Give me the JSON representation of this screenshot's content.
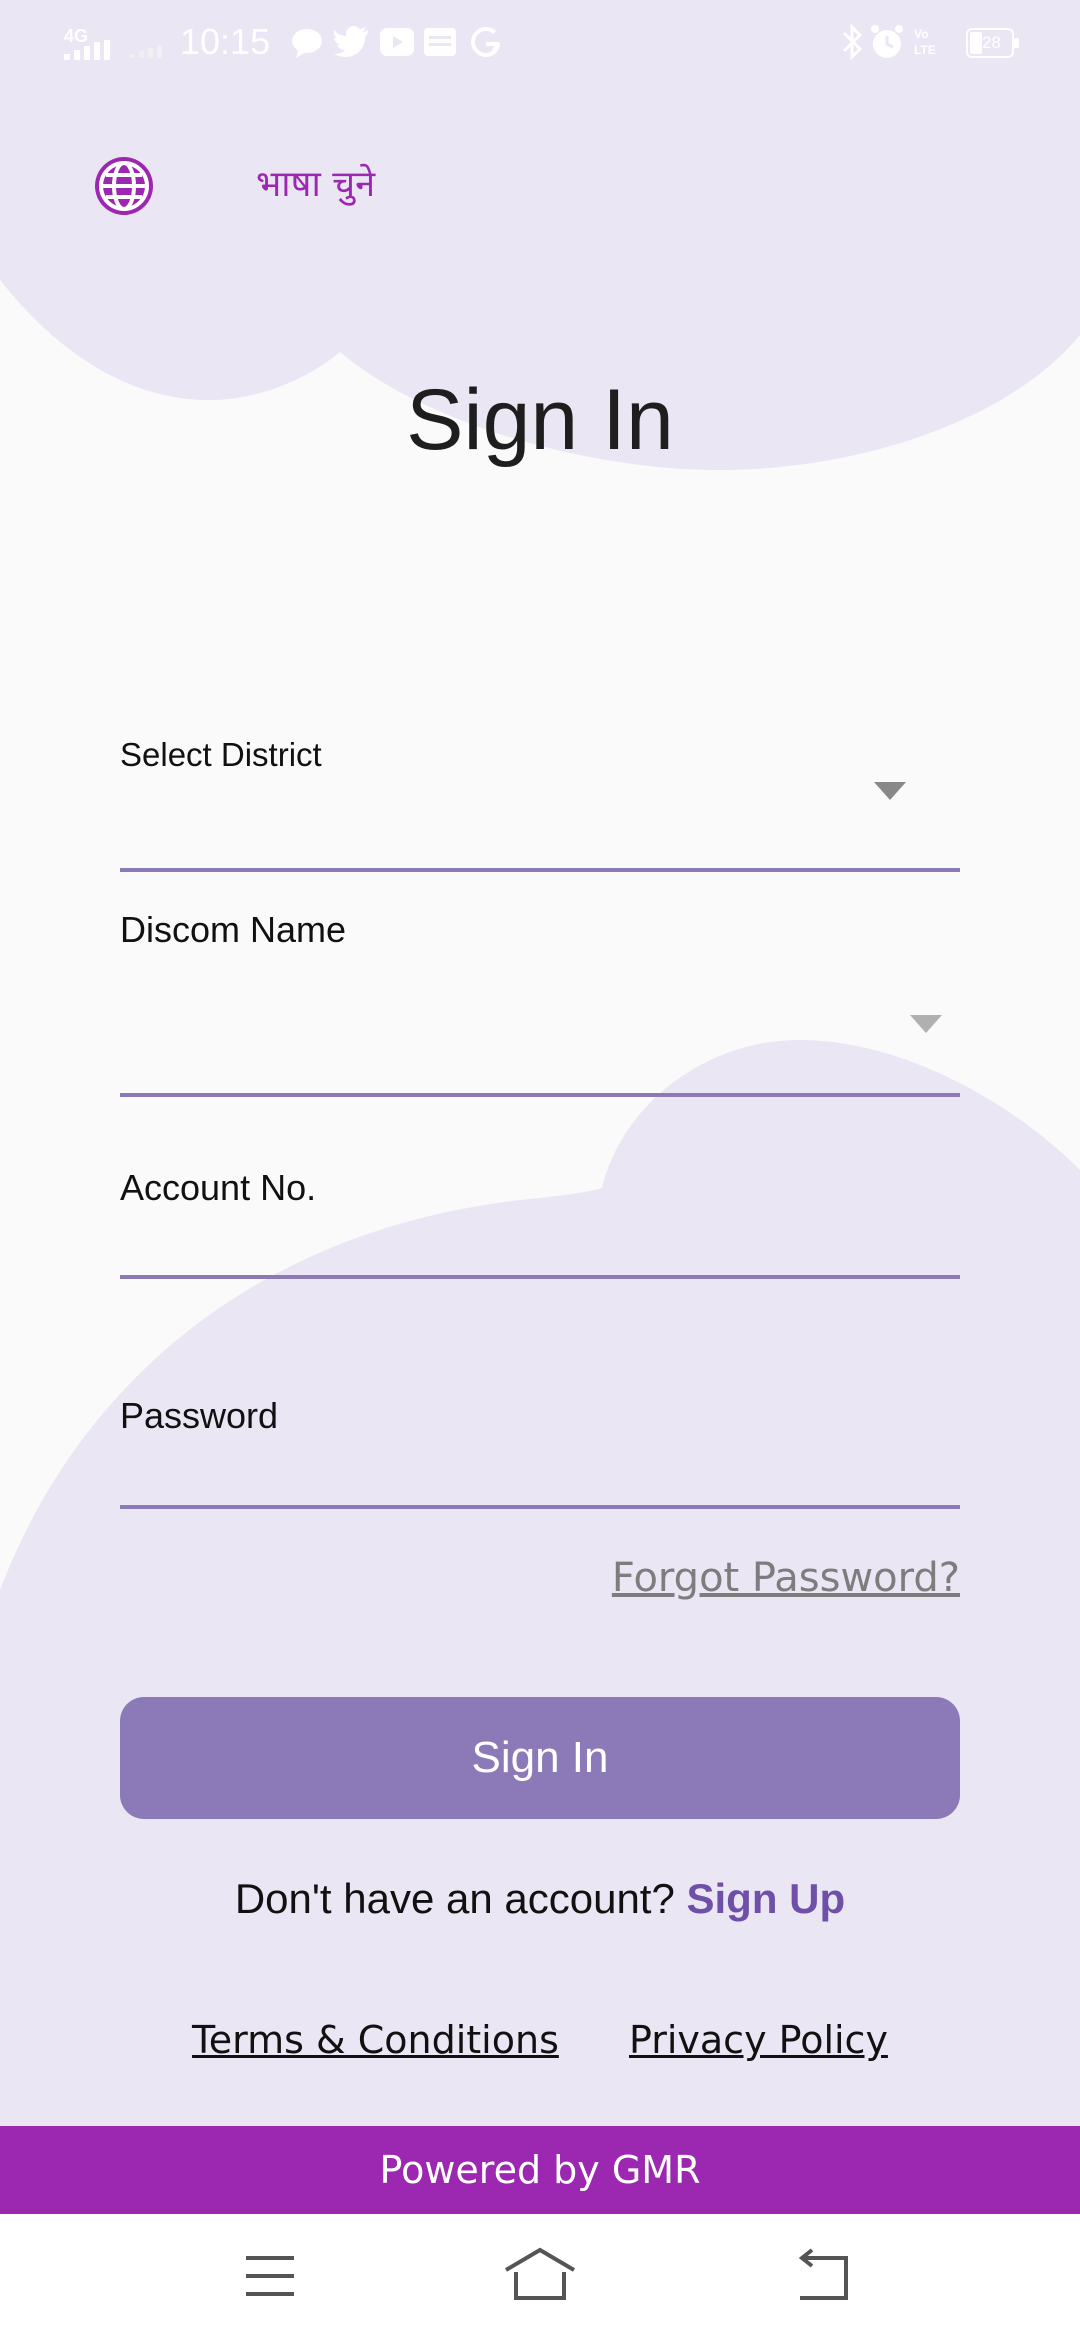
{
  "status_bar": {
    "time": "10:15",
    "network": "4G",
    "battery": "28",
    "icons": [
      "signal-icon",
      "wifi-icon",
      "chat-icon",
      "twitter-icon",
      "youtube-icon",
      "news-icon",
      "google-icon",
      "bluetooth-icon",
      "alarm-icon",
      "volte-icon",
      "battery-icon"
    ]
  },
  "language": {
    "label": "भाषा चुने",
    "icon": "globe-icon"
  },
  "page": {
    "title": "Sign In"
  },
  "form": {
    "district": {
      "label": "Select District",
      "value": ""
    },
    "discom": {
      "label": "Discom Name",
      "value": ""
    },
    "account": {
      "label": "Account No.",
      "value": ""
    },
    "password": {
      "label": "Password",
      "value": ""
    },
    "forgot_password": "Forgot Password?",
    "submit_label": "Sign In"
  },
  "signup": {
    "prompt": "Don't have an account?",
    "link": "Sign Up"
  },
  "legal": {
    "terms": "Terms & Conditions",
    "privacy": "Privacy Policy"
  },
  "footer": {
    "text": "Powered by GMR"
  },
  "colors": {
    "primary": "#9c27b0",
    "button": "#8b7ab7",
    "underline": "#8c7ab8",
    "background_shape": "#ebe6f4",
    "link": "#6f50a8"
  },
  "nav_bar": {
    "buttons": [
      "menu-icon",
      "home-icon",
      "back-icon"
    ]
  }
}
